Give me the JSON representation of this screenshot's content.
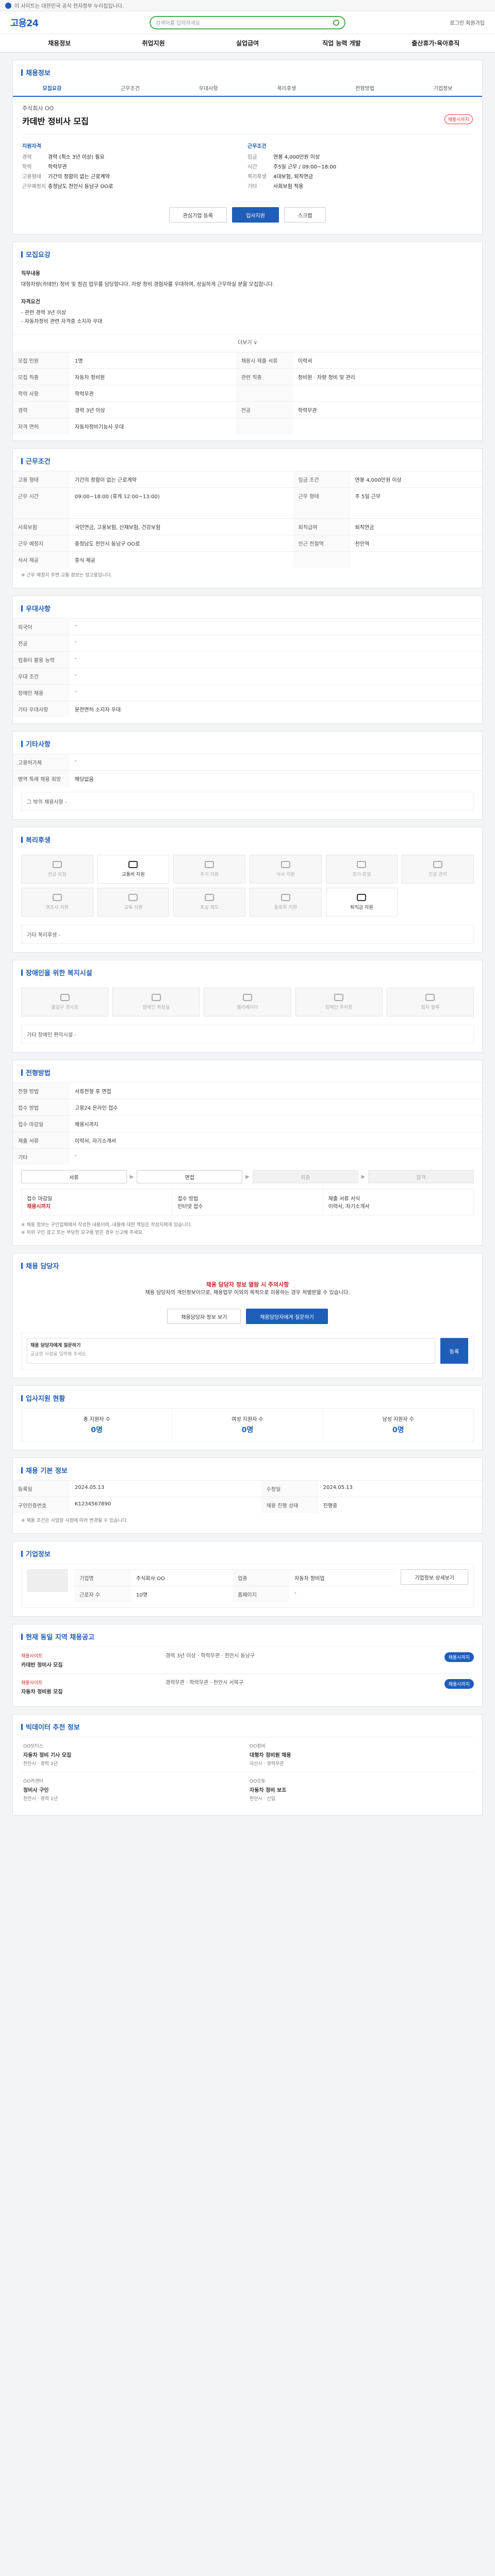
{
  "topbar": {
    "text": "이 사이트는 대한민국 공식 전자정부 누리집입니다."
  },
  "header": {
    "logo": "고용24",
    "search_placeholder": "검색어를 입력하세요",
    "right": "로그인 회원가입"
  },
  "nav": [
    "채용정보",
    "취업지원",
    "실업급여",
    "직업 능력 개발",
    "출산휴가·육아휴직"
  ],
  "section_title": "채용정보",
  "tabs": [
    "모집요강",
    "근무조건",
    "우대사항",
    "복리후생",
    "전형방법",
    "기업정보"
  ],
  "job": {
    "company": "주식회사 OO",
    "title": "카데반 정비사 모집",
    "badge": "채용시까지",
    "summary_left_title": "지원자격",
    "summary_right_title": "근무조건",
    "left_rows": [
      {
        "k": "경력",
        "v": "경력 (최소 3년 이상) 필요"
      },
      {
        "k": "학력",
        "v": "학력무관"
      },
      {
        "k": "고용형태",
        "v": "기간의 정함이 없는 근로계약"
      },
      {
        "k": "근무예정지",
        "v": "충청남도 천안시 동남구 OO로"
      }
    ],
    "right_rows": [
      {
        "k": "임금",
        "v": "연봉 4,000만원 이상"
      },
      {
        "k": "시간",
        "v": "주5일 근무 / 09:00~18:00"
      },
      {
        "k": "복리후생",
        "v": "4대보험, 퇴직연금"
      },
      {
        "k": "기타",
        "v": "사회보험 적용"
      }
    ],
    "btn_interest": "관심기업 등록",
    "btn_apply": "입사지원",
    "btn_scrap": "스크랩"
  },
  "recruit": {
    "title": "모집요강",
    "job_desc_title": "직무내용",
    "job_desc": "대형차량(카데반) 정비 및 점검 업무를 담당합니다. 차량 정비 경험자를 우대하며, 성실하게 근무하실 분을 모집합니다.",
    "detail_title": "자격요건",
    "detail": "- 관련 경력 3년 이상\n- 자동차정비 관련 자격증 소지자 우대",
    "expand": "더보기 ∨",
    "rows": [
      {
        "k": "모집 인원",
        "v": "1명",
        "k2": "채용시 제출 서류",
        "v2": "이력서"
      },
      {
        "k": "모집 직종",
        "v": "자동차 정비원",
        "k2": "관련 직종",
        "v2": "정비원 · 차량 정비 및 관리"
      },
      {
        "k": "학력 사항",
        "v": "학력무관",
        "k2": "",
        "v2": ""
      },
      {
        "k": "경력",
        "v": "경력 3년 이상",
        "k2": "전공",
        "v2": "학력무관"
      },
      {
        "k": "자격 면허",
        "v": "자동차정비기능사 우대",
        "k2": "",
        "v2": ""
      }
    ]
  },
  "work": {
    "title": "근무조건",
    "rows": [
      {
        "k": "고용 형태",
        "v": "기간의 정함이 없는 근로계약",
        "k2": "임금 조건",
        "v2": "연봉 4,000만원 이상"
      },
      {
        "k": "근무 시간",
        "v": "09:00~18:00 (휴게 12:00~13:00)",
        "k2": "근무 형태",
        "v2": "주 5일 근무"
      },
      {
        "k": "사회보험",
        "v": "국민연금, 고용보험, 산재보험, 건강보험",
        "k2": "퇴직급여",
        "v2": "퇴직연금"
      },
      {
        "k": "근무 예정지",
        "v": "충청남도 천안시 동남구 OO로",
        "k2": "인근 전철역",
        "v2": "천안역"
      },
      {
        "k": "식사 제공",
        "v": "중식 제공",
        "k2": "",
        "v2": ""
      }
    ],
    "note": "※ 근무 예정지 주변 교통 정보는 참고용입니다."
  },
  "prefer": {
    "title": "우대사항",
    "rows": [
      {
        "k": "외국어",
        "v": "-"
      },
      {
        "k": "전공",
        "v": "-"
      },
      {
        "k": "컴퓨터 활용 능력",
        "v": "-"
      },
      {
        "k": "우대 조건",
        "v": "-"
      },
      {
        "k": "장애인 채용",
        "v": "-"
      },
      {
        "k": "기타 우대사항",
        "v": "운전면허 소지자 우대"
      }
    ]
  },
  "etc": {
    "title": "기타사항",
    "rows": [
      {
        "k": "고용허가제",
        "v": "-"
      },
      {
        "k": "병역 특례 채용 희망",
        "v": "해당없음"
      }
    ],
    "more": "그 밖의 채용사항 -"
  },
  "welfare": {
    "title": "복리후생",
    "items": [
      {
        "label": "연금·보험",
        "on": false
      },
      {
        "label": "교통비 지원",
        "on": true
      },
      {
        "label": "주거 지원",
        "on": false
      },
      {
        "label": "식사 지원",
        "on": false
      },
      {
        "label": "휴가·휴일",
        "on": false
      },
      {
        "label": "건강 관리",
        "on": false
      },
      {
        "label": "경조사 지원",
        "on": false
      },
      {
        "label": "교육 지원",
        "on": false
      },
      {
        "label": "포상 제도",
        "on": false
      },
      {
        "label": "동호회 지원",
        "on": false
      },
      {
        "label": "퇴직금 지원",
        "on": true
      }
    ],
    "other_label": "기타 복리후생",
    "other_value": "-"
  },
  "disability": {
    "title": "장애인을 위한 복지시설",
    "items": [
      "출입구 경사로",
      "장애인 화장실",
      "엘리베이터",
      "장애인 주차장",
      "점자 블록"
    ],
    "other_label": "기타 장애인 편의시설",
    "other_value": "-"
  },
  "process": {
    "title": "전형방법",
    "steps": [
      "서류",
      "면접",
      "최종",
      "합격"
    ],
    "rows": [
      {
        "k": "전형 방법",
        "v": "서류전형 후 면접"
      },
      {
        "k": "접수 방법",
        "v": "고용24 온라인 접수"
      },
      {
        "k": "접수 마감일",
        "v": "채용시까지"
      },
      {
        "k": "제출 서류",
        "v": "이력서, 자기소개서"
      },
      {
        "k": "기타",
        "v": "-"
      }
    ],
    "apply_left_title": "접수 마감일",
    "apply_left_value": "채용시까지",
    "apply_mid_title": "접수 방법",
    "apply_mid_value": "인터넷 접수",
    "apply_right_title": "제출 서류 서식",
    "apply_right_value": "이력서, 자기소개서",
    "notes": "※ 채용 정보는 구인업체에서 작성한 내용이며, 내용에 대한 책임은 작성자에게 있습니다.\n※ 허위 구인 광고 또는 부당한 요구를 받은 경우 신고해 주세요."
  },
  "manager": {
    "title": "채용 담당자",
    "warning": "채용 담당자 정보 열람 시 주의사항",
    "desc": "채용 담당자의 개인정보이므로, 채용업무 이외의 목적으로 이용하는 경우 처벌받을 수 있습니다.",
    "btn_contact": "채용담당자 정보 보기",
    "btn_question": "채용담당자에게 질문하기",
    "qa_title": "채용 담당자에게 질문하기",
    "qa_placeholder": "궁금한 사항을 입력해 주세요.",
    "qa_go": "등록"
  },
  "stats": {
    "title": "입사지원 현황",
    "items": [
      {
        "label": "총 지원자 수",
        "value": "0명"
      },
      {
        "label": "여성 지원자 수",
        "value": "0명"
      },
      {
        "label": "남성 지원자 수",
        "value": "0명"
      }
    ]
  },
  "info": {
    "title": "채용 기본 정보",
    "rows": [
      {
        "k": "등록일",
        "v": "2024.05.13",
        "k2": "수정일",
        "v2": "2024.05.13"
      },
      {
        "k": "구인인증번호",
        "v": "K1234567890",
        "k2": "채용 진행 상태",
        "v2": "진행중"
      }
    ],
    "note": "※ 채용 조건은 사업장 사정에 따라 변경될 수 있습니다."
  },
  "company": {
    "title": "기업정보",
    "rows": [
      {
        "k": "기업명",
        "v": "주식회사 OO"
      },
      {
        "k": "업종",
        "v": "자동차 정비업"
      },
      {
        "k": "근로자 수",
        "v": "10명"
      },
      {
        "k": "홈페이지",
        "v": "-"
      }
    ],
    "btn": "기업정보 상세보기"
  },
  "similar": {
    "title": "현재 동일 지역 채용공고",
    "items": [
      {
        "company": "채용사이트",
        "title": "카데반 정비사 모집",
        "meta": "경력 3년 이상 · 학력무관 · 천안시 동남구",
        "tag": "채용시까지"
      },
      {
        "company": "채용사이트",
        "title": "자동차 정비원 모집",
        "meta": "경력무관 · 학력무관 · 천안시 서북구",
        "tag": "채용시까지"
      }
    ]
  },
  "recommend": {
    "title": "빅데이터 추천 정보",
    "items": [
      {
        "company": "OO모터스",
        "title": "자동차 정비 기사 모집",
        "meta": "천안시 · 경력 2년"
      },
      {
        "company": "OO정비",
        "title": "대형차 정비원 채용",
        "meta": "아산시 · 경력무관"
      },
      {
        "company": "OO카센터",
        "title": "정비사 구인",
        "meta": "천안시 · 경력 1년"
      },
      {
        "company": "OO오토",
        "title": "자동차 정비 보조",
        "meta": "천안시 · 신입"
      }
    ]
  },
  "colors": {
    "primary": "#1f5eb8",
    "accent": "#c62828",
    "search_border": "#4caf50"
  }
}
